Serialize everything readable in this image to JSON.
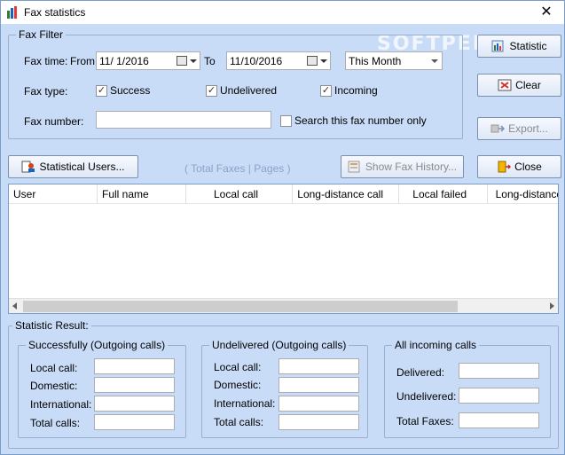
{
  "window": {
    "title": "Fax statistics",
    "watermark": "SOFTPEDIA"
  },
  "filter": {
    "legend": "Fax Filter",
    "fax_time_label": "Fax time:",
    "from_label": "From",
    "from_date": "11/  1/2016",
    "to_label": "To",
    "to_date": "11/10/2016",
    "period": "This Month",
    "fax_type_label": "Fax type:",
    "types": [
      {
        "label": "Success",
        "checked": true
      },
      {
        "label": "Undelivered",
        "checked": true
      },
      {
        "label": "Incoming",
        "checked": true
      }
    ],
    "fax_number_label": "Fax number:",
    "fax_number_value": "",
    "search_only_label": "Search this fax number only"
  },
  "buttons": {
    "statistic": "Statistic",
    "clear": "Clear",
    "export": "Export...",
    "statistical_users": "Statistical Users...",
    "show_history": "Show Fax History...",
    "close": "Close"
  },
  "pages_text": "( Total Faxes | Pages )",
  "grid": {
    "columns": [
      "User",
      "Full name",
      "Local call",
      "Long-distance call",
      "Local failed",
      "Long-distance"
    ]
  },
  "result": {
    "legend": "Statistic Result:",
    "success": {
      "legend": "Successfully (Outgoing calls)",
      "rows": [
        "Local call:",
        "Domestic:",
        "International:",
        "Total calls:"
      ]
    },
    "undelivered": {
      "legend": "Undelivered (Outgoing calls)",
      "rows": [
        "Local call:",
        "Domestic:",
        "International:",
        "Total calls:"
      ]
    },
    "incoming": {
      "legend": "All incoming calls",
      "rows": [
        "Delivered:",
        "Undelivered:",
        "Total Faxes:"
      ]
    }
  }
}
